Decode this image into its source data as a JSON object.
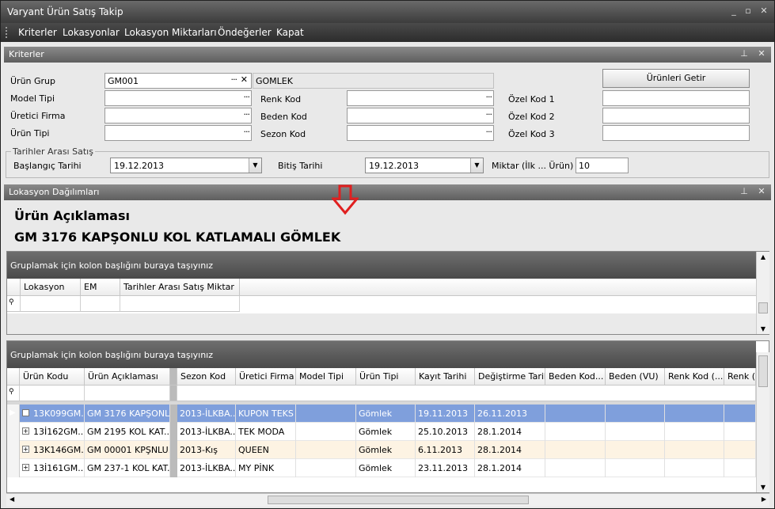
{
  "window": {
    "title": "Varyant Ürün Satış Takip"
  },
  "menu": [
    "Kriterler",
    "Lokasyonlar",
    "Lokasyon Miktarları",
    "Öndeğerler",
    "Kapat"
  ],
  "criteria": {
    "panel_title": "Kriterler",
    "urun_grup": {
      "label": "Ürün Grup",
      "value": "GM001",
      "desc": "GOMLEK"
    },
    "model_tipi": {
      "label": "Model Tipi",
      "value": ""
    },
    "uretici_firma": {
      "label": "Üretici Firma",
      "value": ""
    },
    "urun_tipi": {
      "label": "Ürün Tipi",
      "value": ""
    },
    "renk_kod": {
      "label": "Renk Kod",
      "value": ""
    },
    "beden_kod": {
      "label": "Beden Kod",
      "value": ""
    },
    "sezon_kod": {
      "label": "Sezon Kod",
      "value": ""
    },
    "ozel_kod1": {
      "label": "Özel Kod 1",
      "value": ""
    },
    "ozel_kod2": {
      "label": "Özel Kod 2",
      "value": ""
    },
    "ozel_kod3": {
      "label": "Özel Kod 3",
      "value": ""
    },
    "fetch_button": "Ürünleri Getir",
    "date_group": "Tarihler Arası Satış",
    "start_label": "Başlangıç Tarihi",
    "start_value": "19.12.2013",
    "end_label": "Bitiş Tarihi",
    "end_value": "19.12.2013",
    "qty_label": "Miktar (İlk ... Ürün)",
    "qty_value": "10"
  },
  "location": {
    "panel_title": "Lokasyon Dağılımları",
    "desc_heading": "Ürün Açıklaması",
    "desc_value": "GM 3176 KAPŞONLU KOL KATLAMALI GÖMLEK",
    "group_hint": "Gruplamak için kolon başlığını buraya taşıyınız",
    "columns": [
      "Lokasyon",
      "EM",
      "Tarihler Arası Satış Miktar"
    ]
  },
  "products": {
    "group_hint": "Gruplamak için kolon başlığını buraya taşıyınız",
    "columns": [
      "Ürün Kodu",
      "Ürün Açıklaması",
      "Sezon Kod",
      "Üretici Firma",
      "Model Tipi",
      "Ürün Tipi",
      "Kayıt Tarihi",
      "Değiştirme Tarihi",
      "Beden Kod...",
      "Beden (VU)",
      "Renk Kod (...",
      "Renk (VU)"
    ],
    "rows": [
      {
        "code": "13K099GM...",
        "desc": "GM 3176 KAPŞONL...",
        "season": "2013-İLKBA...",
        "firm": "KUPON TEKS",
        "model": "",
        "type": "Gömlek",
        "created": "19.11.2013",
        "modified": "26.11.2013"
      },
      {
        "code": "13İ162GM...",
        "desc": "GM 2195 KOL KAT...",
        "season": "2013-İLKBA...",
        "firm": "TEK MODA",
        "model": "",
        "type": "Gömlek",
        "created": "25.10.2013",
        "modified": "28.1.2014"
      },
      {
        "code": "13K146GM...",
        "desc": "GM 00001 KPŞNLU...",
        "season": "2013-Kış",
        "firm": "QUEEN",
        "model": "",
        "type": "Gömlek",
        "created": "6.11.2013",
        "modified": "28.1.2014"
      },
      {
        "code": "13İ161GM...",
        "desc": "GM 237-1 KOL KAT...",
        "season": "2013-İLKBA...",
        "firm": "MY PİNK",
        "model": "",
        "type": "Gömlek",
        "created": "23.11.2013",
        "modified": "28.1.2014"
      }
    ]
  },
  "colors": {
    "selected_row": "#7f9fdc",
    "alt_row": "#fdf3e3",
    "row": "#ffffff",
    "arrow": "#e02020"
  }
}
